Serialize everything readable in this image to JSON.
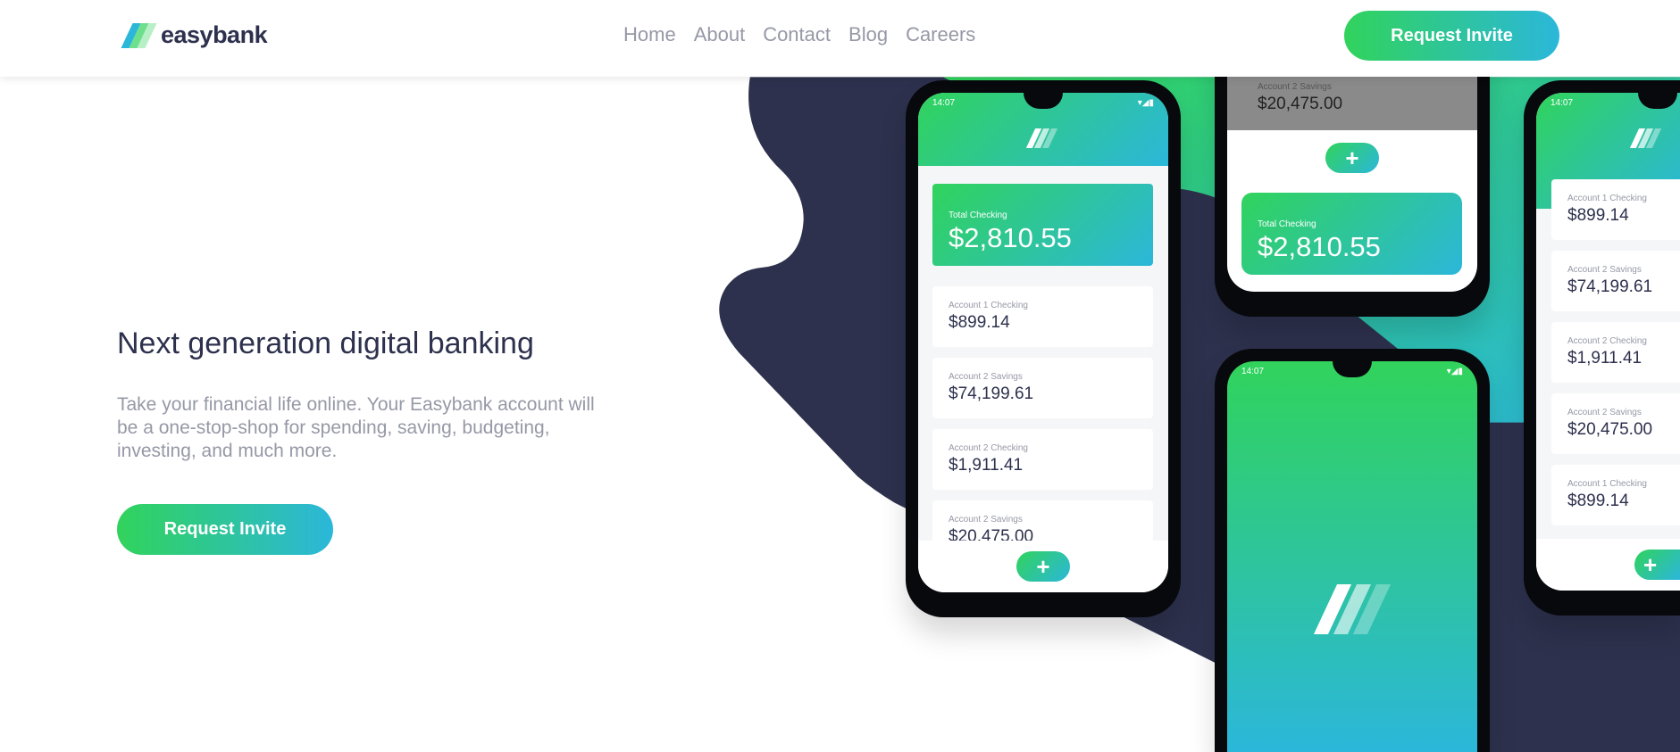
{
  "header": {
    "brand": "easybank",
    "nav": [
      "Home",
      "About",
      "Contact",
      "Blog",
      "Careers"
    ],
    "cta": "Request Invite"
  },
  "hero": {
    "title": "Next generation digital banking",
    "description": "Take your financial life online. Your Easybank account will be a one-stop-shop for spending, saving, budgeting, investing, and much more.",
    "cta": "Request Invite"
  },
  "phones": {
    "time": "14:07",
    "total_label": "Total Checking",
    "total_value": "$2,810.55",
    "plus": "+",
    "left_accounts": [
      {
        "l": "Account 1 Checking",
        "v": "$899.14"
      },
      {
        "l": "Account 2 Savings",
        "v": "$74,199.61"
      },
      {
        "l": "Account 2 Checking",
        "v": "$1,911.41"
      },
      {
        "l": "Account 2 Savings",
        "v": "$20,475.00"
      }
    ],
    "top_account": {
      "l": "Account 2 Savings",
      "v": "$20,475.00"
    },
    "right_accounts": [
      {
        "l": "Account 1 Checking",
        "v": "$899.14"
      },
      {
        "l": "Account 2 Savings",
        "v": "$74,199.61"
      },
      {
        "l": "Account 2 Checking",
        "v": "$1,911.41"
      },
      {
        "l": "Account 2 Savings",
        "v": "$20,475.00"
      },
      {
        "l": "Account 1 Checking",
        "v": "$899.14"
      }
    ]
  },
  "colors": {
    "dark": "#2d314d",
    "green": "#31d35c",
    "cyan": "#2bb7da",
    "grey": "#9698a6"
  }
}
